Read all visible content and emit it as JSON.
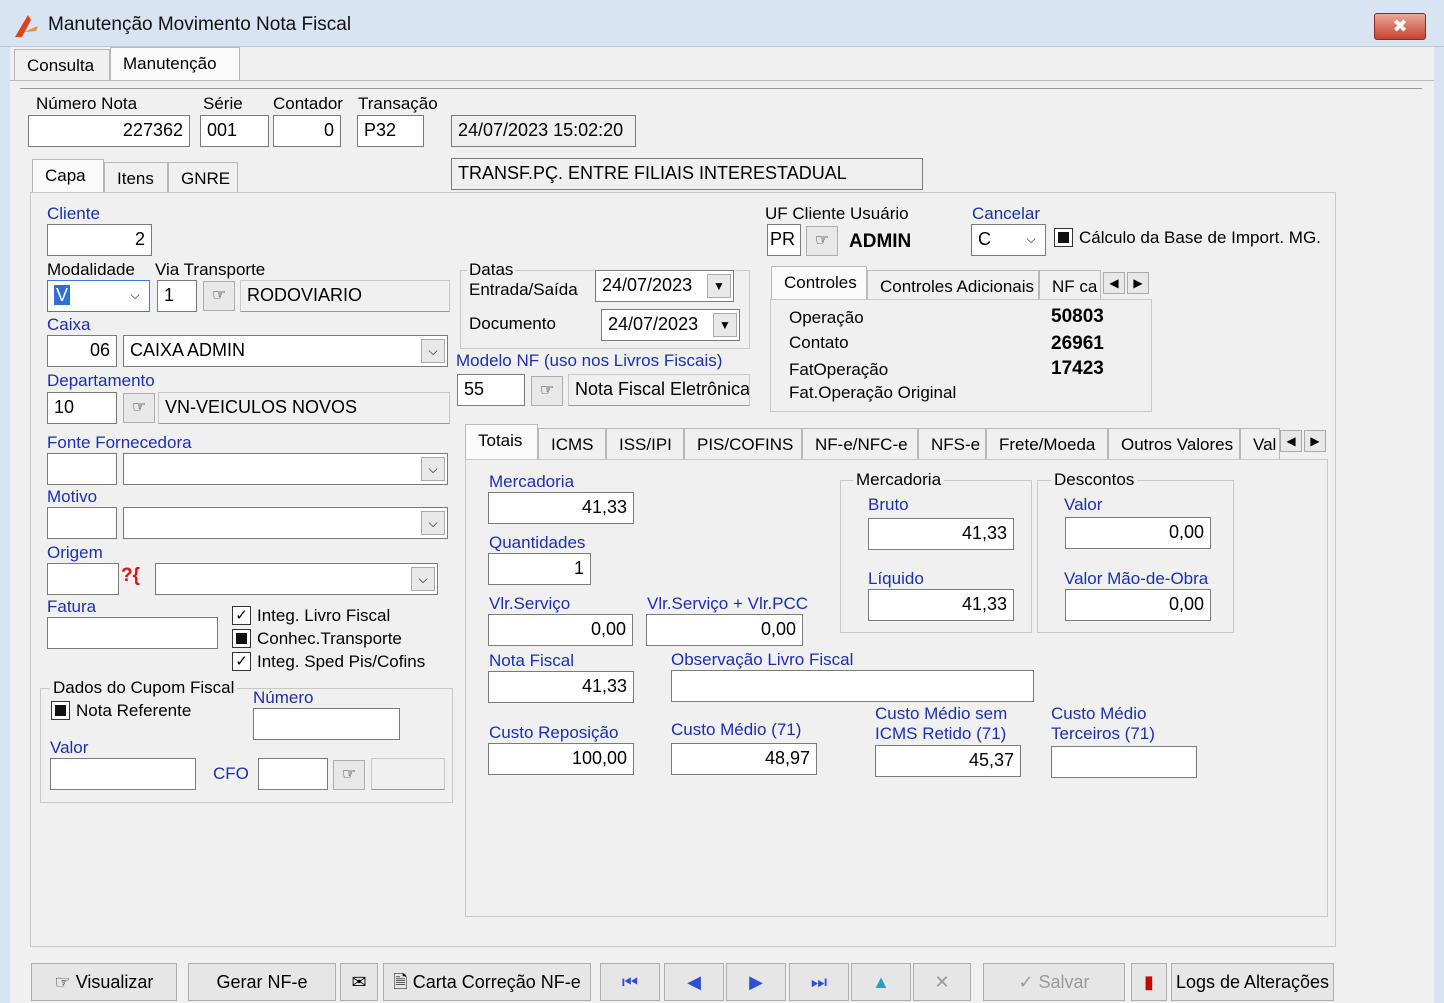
{
  "window": {
    "title": "Manutenção Movimento Nota Fiscal",
    "close": "✖"
  },
  "main_tabs": [
    "Consulta",
    "Manutenção"
  ],
  "header": {
    "numero_nota_label": "Número Nota",
    "numero_nota": "227362",
    "serie_label": "Série",
    "serie": "001",
    "contador_label": "Contador",
    "contador": "0",
    "transacao_label": "Transação",
    "transacao": "P32",
    "datetime": "24/07/2023 15:02:20",
    "transacao_desc": "TRANSF.PÇ. ENTRE FILIAIS INTERESTADUAL"
  },
  "sub_tabs": [
    "Capa",
    "Itens",
    "GNRE"
  ],
  "capa": {
    "cliente_label": "Cliente",
    "cliente": "2",
    "modalidade_label": "Modalidade",
    "modalidade": "V",
    "via_transporte_label": "Via Transporte",
    "via_transporte": "1",
    "via_transporte_desc": "RODOVIARIO",
    "caixa_label": "Caixa",
    "caixa": "06",
    "caixa_desc": "CAIXA ADMIN",
    "departamento_label": "Departamento",
    "departamento": "10",
    "departamento_desc": "VN-VEICULOS NOVOS",
    "fonte_label": "Fonte Fornecedora",
    "motivo_label": "Motivo",
    "origem_label": "Origem",
    "origem_icon": "?{",
    "fatura_label": "Fatura",
    "chk_livro": "Integ. Livro Fiscal",
    "chk_conhec": "Conhec.Transporte",
    "chk_sped": "Integ. Sped Pis/Cofins",
    "cupom_group": "Dados do Cupom Fiscal",
    "nota_referente": "Nota Referente",
    "numero_label": "Número",
    "valor_label": "Valor",
    "cfo_label": "CFO"
  },
  "datas": {
    "group": "Datas",
    "entrada_label": "Entrada/Saída",
    "entrada": "24/07/2023",
    "documento_label": "Documento",
    "documento": "24/07/2023"
  },
  "modelo": {
    "label": "Modelo NF (uso nos Livros Fiscais)",
    "value": "55",
    "desc": "Nota Fiscal Eletrônica"
  },
  "uf": {
    "label": "UF Cliente Usuário",
    "uf": "PR",
    "user": "ADMIN"
  },
  "cancelar": {
    "label": "Cancelar",
    "value": "C",
    "calc_label": "Cálculo da Base de Import. MG."
  },
  "controles": {
    "tabs": [
      "Controles",
      "Controles Adicionais",
      "NF ca"
    ],
    "operacao_label": "Operação",
    "operacao": "50803",
    "contato_label": "Contato",
    "contato": "26961",
    "fatop_label": "FatOperação",
    "fatop": "17423",
    "fatop_orig_label": "Fat.Operação Original"
  },
  "totais_tabs": [
    "Totais",
    "ICMS",
    "ISS/IPI",
    "PIS/COFINS",
    "NF-e/NFC-e",
    "NFS-e",
    "Frete/Moeda",
    "Outros Valores",
    "Val"
  ],
  "totais": {
    "mercadoria_label": "Mercadoria",
    "mercadoria": "41,33",
    "quantidades_label": "Quantidades",
    "quantidades": "1",
    "vlr_servico_label": "Vlr.Serviço",
    "vlr_servico": "0,00",
    "vlr_servico_pcc_label": "Vlr.Serviço + Vlr.PCC",
    "vlr_servico_pcc": "0,00",
    "nota_fiscal_label": "Nota Fiscal",
    "nota_fiscal": "41,33",
    "obs_livro_label": "Observação Livro Fiscal",
    "custo_rep_label": "Custo Reposição",
    "custo_rep": "100,00",
    "custo_medio_label": "Custo Médio (71)",
    "custo_medio": "48,97",
    "custo_medio_sem_label1": "Custo Médio sem",
    "custo_medio_sem_label2": "ICMS Retido (71)",
    "custo_medio_sem": "45,37",
    "custo_terc_label1": "Custo Médio",
    "custo_terc_label2": "Terceiros (71)",
    "merc_group": "Mercadoria",
    "bruto_label": "Bruto",
    "bruto": "41,33",
    "liquido_label": "Líquido",
    "liquido": "41,33",
    "desc_group": "Descontos",
    "valor_label": "Valor",
    "valor": "0,00",
    "mao_obra_label": "Valor Mão-de-Obra",
    "mao_obra": "0,00"
  },
  "toolbar": {
    "visualizar": "Visualizar",
    "gerar_nfe": "Gerar NF-e",
    "carta": "Carta Correção NF-e",
    "salvar": "Salvar",
    "logs": "Logs de Alterações"
  }
}
